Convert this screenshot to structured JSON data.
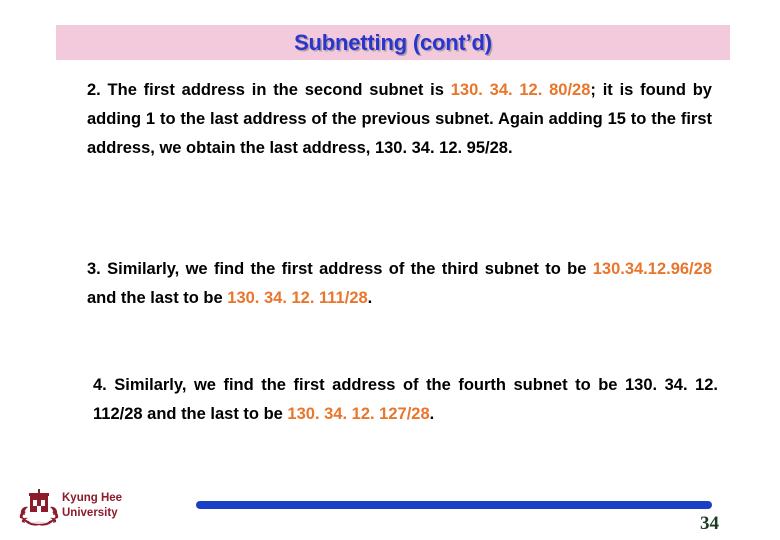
{
  "slide": {
    "title": "Subnetting (cont’d)",
    "title_color": "#2a35cc",
    "banner_color": "#f2cadb",
    "highlight_color": "#e8762c",
    "body_color": "#000000"
  },
  "paragraphs": [
    {
      "number": "2.",
      "segments": [
        {
          "text": "2.  The  first  address  in  the  second  subnet  is ",
          "color": "#000000"
        },
        {
          "text": "130. 34. 12. 80/28",
          "color": "#e8762c"
        },
        {
          "text": "; it  is  found  by  adding  1  to  the  last address  of  the  previous  subnet.  Again  adding  15  to the   first   address,   we   obtain   the   last   address, ",
          "color": "#000000"
        },
        {
          "text": "130. 34. 12. 95/28.",
          "color": "#000000"
        }
      ]
    },
    {
      "number": "3.",
      "segments": [
        {
          "text": "3.  Similarly,  we  find  the  first  address  of  the  third subnet  to  be  ",
          "color": "#000000"
        },
        {
          "text": "130.34.12.96/28",
          "color": "#e8762c"
        },
        {
          "text": "  and  the  last  to  be ",
          "color": "#000000"
        },
        {
          "text": "130. 34. 12. 111/28",
          "color": "#e8762c"
        },
        {
          "text": ".",
          "color": "#000000"
        }
      ]
    },
    {
      "number": "4.",
      "segments": [
        {
          "text": "4.  Similarly,  we  find  the  first  address  of  the  fourth subnet  to  be  ",
          "color": "#000000"
        },
        {
          "text": "130. 34. 12. 112/28",
          "color": "#000000"
        },
        {
          "text": "  and  the  last  to  be ",
          "color": "#000000"
        },
        {
          "text": "130. 34. 12. 127/28",
          "color": "#e8762c"
        },
        {
          "text": ".",
          "color": "#000000"
        }
      ]
    }
  ],
  "footer": {
    "logo_line1": "Kyung Hee",
    "logo_line2": "University",
    "logo_color": "#8b1c2b",
    "bar_color": "#1b3fc4",
    "page_number": "34",
    "page_number_color": "#1c3a22"
  }
}
